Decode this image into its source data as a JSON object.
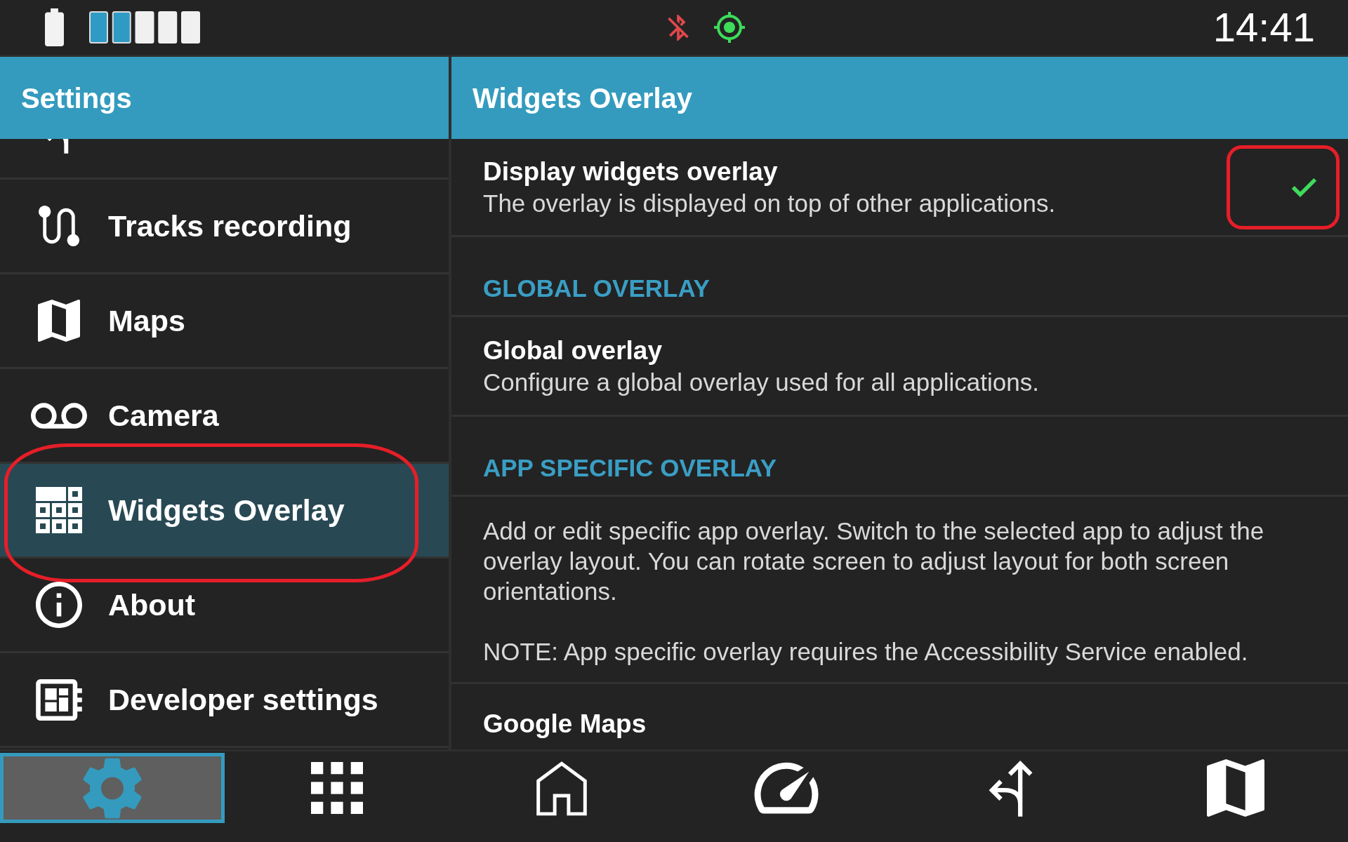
{
  "status_bar": {
    "meter": {
      "level": 0.4
    },
    "indicators": [
      {
        "kind": "bluetooth-off",
        "color": "#e0474c"
      },
      {
        "kind": "gps",
        "color": "#3ddc5a"
      }
    ],
    "time": "14:41"
  },
  "sidebar": {
    "title": "Settings",
    "items": [
      {
        "kind": "roadbook",
        "selected": false,
        "highlighted": false
      },
      {
        "kind": "tracks",
        "label": "Tracks recording",
        "selected": false,
        "highlighted": false
      },
      {
        "kind": "maps",
        "label": "Maps",
        "selected": false,
        "highlighted": false
      },
      {
        "kind": "camera",
        "label": "Camera",
        "selected": false,
        "highlighted": false
      },
      {
        "kind": "widgets",
        "label": "Widgets Overlay",
        "selected": true,
        "highlighted": true
      },
      {
        "kind": "about",
        "label": "About",
        "selected": false,
        "highlighted": false
      },
      {
        "kind": "developer",
        "label": "Developer settings",
        "selected": false,
        "highlighted": false
      }
    ]
  },
  "content": {
    "title": "Widgets Overlay",
    "rows": [
      {
        "kind": "checkbox",
        "title": "Display widgets overlay",
        "summary": "The overlay is displayed on top of other applications.",
        "checked": true,
        "highlighted": true
      },
      {
        "kind": "category",
        "title": "GLOBAL OVERLAY"
      },
      {
        "kind": "link",
        "title": "Global overlay",
        "summary": "Configure a global overlay used for all applications."
      },
      {
        "kind": "category",
        "title": "APP SPECIFIC OVERLAY"
      },
      {
        "kind": "note",
        "summary": "Add or edit specific app overlay. Switch to the selected app to adjust the overlay layout. You can rotate screen to adjust layout for both screen orientations.\n\nNOTE: App specific overlay requires the Accessibility Service enabled."
      },
      {
        "kind": "link",
        "title": "Google Maps"
      }
    ]
  },
  "nav": [
    {
      "kind": "settings",
      "selected": true
    },
    {
      "kind": "apps",
      "selected": false
    },
    {
      "kind": "home",
      "selected": false
    },
    {
      "kind": "dashboard",
      "selected": false
    },
    {
      "kind": "roadbook",
      "selected": false
    },
    {
      "kind": "maps",
      "selected": false
    }
  ]
}
